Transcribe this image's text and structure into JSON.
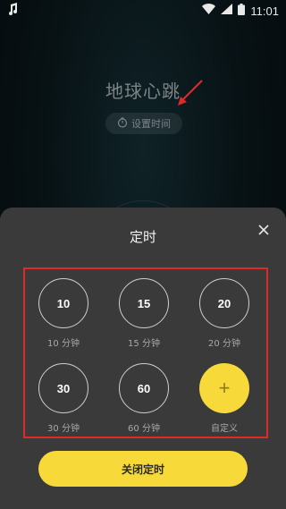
{
  "status_bar": {
    "time": "11:01",
    "icons": [
      "music-note-icon",
      "wifi-icon",
      "signal-icon",
      "battery-icon"
    ]
  },
  "background": {
    "title": "地球心跳",
    "set_time_label": "设置时间"
  },
  "sheet": {
    "title": "定时",
    "options": [
      {
        "value": "10",
        "label": "10 分钟"
      },
      {
        "value": "15",
        "label": "15 分钟"
      },
      {
        "value": "20",
        "label": "20 分钟"
      },
      {
        "value": "30",
        "label": "30 分钟"
      },
      {
        "value": "60",
        "label": "60 分钟"
      },
      {
        "value": "+",
        "label": "自定义"
      }
    ],
    "close_timer_label": "关闭定时"
  },
  "colors": {
    "accent_yellow": "#f7d93a",
    "sheet_bg": "#3a3a3a",
    "highlight_red": "#e02a2a"
  }
}
